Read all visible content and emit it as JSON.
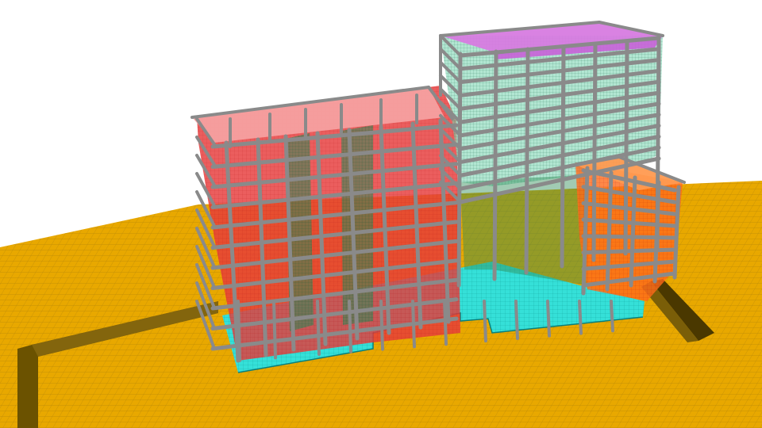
{
  "scene": {
    "subject": "fem-building-model",
    "colors": {
      "background": "#ffffff",
      "ground": "#e8a800",
      "ground_mesh": "#8a6a10",
      "trench": "#5a4500",
      "foundation": "#35e0d8",
      "slab_main": "#f07a7a",
      "slab_tower_roof": "#d77be0",
      "slab_east": "#ff8a2a",
      "wall_core": "#2e8b57",
      "frame": "#8a8a8a",
      "frame_edge": "#555555",
      "tower_glass": "#7fd6b4"
    }
  }
}
